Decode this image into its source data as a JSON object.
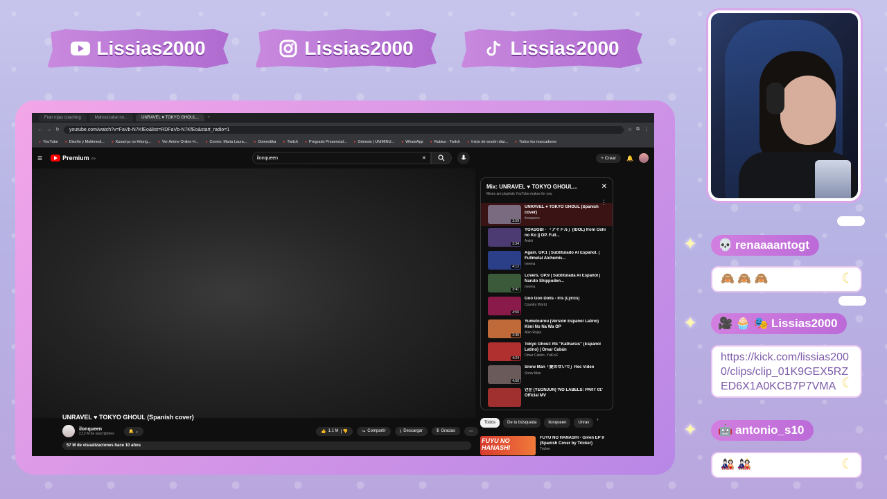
{
  "banners": [
    {
      "platform": "youtube",
      "icon": "youtube-icon",
      "handle": "Lissias2000"
    },
    {
      "platform": "instagram",
      "icon": "instagram-icon",
      "handle": "Lissias2000"
    },
    {
      "platform": "tiktok",
      "icon": "tiktok-icon",
      "handle": "Lissias2000"
    }
  ],
  "browser": {
    "tabs": [
      "Fran rojas coaching",
      "Mahoutsukai no...",
      "UNRAVEL ♥ TOKYO GHOUL..."
    ],
    "url": "youtube.com/watch?v=FaVb-N7KfEo&list=RDFaVb-N7KfEo&start_radio=1",
    "bookmarks": [
      "YouTube",
      "Diseño y Multimedi...",
      "Kusuriya no Hitorig...",
      "Ver Anime Online H...",
      "Correo: Maria Laura...",
      "Domestika",
      "Twitch",
      "Pregrado Presencial...",
      "Génesis | UNIMINU...",
      "WhatsApp",
      "Rubius - Twitch",
      "Inicio de sesión diar...",
      "Todos los marcadores"
    ]
  },
  "youtube": {
    "logo": "Premium",
    "logo_sup": "CO",
    "search_value": "ilonqueen",
    "create_label": "Crear",
    "video_title": "UNRAVEL ♥ TOKYO GHOUL (Spanish cover)",
    "channel": "ilonqueen",
    "subscribers": "2,12 M de suscriptores",
    "likes": "1,1 M",
    "share": "Compartir",
    "download": "Descargar",
    "thanks": "Gracias",
    "views": "57 M de visualizaciones  hace 10 años"
  },
  "playlist": {
    "title": "Mix: UNRAVEL ♥ TOKYO GHOUL...",
    "subtitle": "Mixes are playlists YouTube makes for you",
    "items": [
      {
        "title": "UNRAVEL ♥ TOKYO GHOUL (Spanish cover)",
        "channel": "ilonqueen",
        "duration": "3:59",
        "color": "#7a6b80"
      },
      {
        "title": "YOASOBI - 「アイドル」(IDOL) from Oshi no Ko || OP. Full...",
        "channel": "Anikii",
        "duration": "3:34",
        "color": "#4c3a72"
      },
      {
        "title": "Again. OP.1 | Subtitulado Al Español. | Fullmetal Alchemis...",
        "channel": "meena",
        "duration": "4:12",
        "color": "#2a3f88"
      },
      {
        "title": "Lovers. OP.9 | Subtitulada Al Español | Naruto Shippuden...",
        "channel": "meena",
        "duration": "3:41",
        "color": "#3a5a3a"
      },
      {
        "title": "Goo Goo Dolls - Iris (Lyrics)",
        "channel": "Country World",
        "duration": "4:50",
        "color": "#8a1a4a"
      },
      {
        "title": "Yumetourou (Versión Español Latino) Kimi No Na Wa OP",
        "channel": "Alan Rojas",
        "duration": "2:30",
        "color": "#c06a3a"
      },
      {
        "title": "Tokyo Ghoul: RE \"Katharsis\" (Español Latino) | Omar Cabán",
        "channel": "Omar Cabán -YutFoX",
        "duration": "4:24",
        "color": "#b03030"
      },
      {
        "title": "Snow Man「愛のせいで」Rec Video",
        "channel": "Snow Man",
        "duration": "4:50",
        "color": "#6a5a5a"
      },
      {
        "title": "연준 (YEONJUN) 'NO LABELS: PART 01' Official MV",
        "channel": "",
        "duration": "",
        "color": "#a03030"
      }
    ]
  },
  "chips": [
    "Todos",
    "De tu búsqueda",
    "ilonqueen",
    "Unrav"
  ],
  "recommendation": {
    "thumb_text": "FUYU NO HANASHI",
    "title": "FUYU NO HANASHI - Given EP 9 (Spanish Cover by Tricker)",
    "channel": "Tricker"
  },
  "chat": [
    {
      "user": "renaaaantogt",
      "badges": "💀",
      "message": "🙈 🙈 🙈"
    },
    {
      "user": "Lissias2000",
      "badges": "🎥 🧁 🎭",
      "message": "https://kick.com/lissias2000/clips/clip_01K9GEX5RZED6X1A0KCB7P7VMA"
    },
    {
      "user": "antonio_s10",
      "badges": "🤖",
      "message": "🎎 🎎"
    }
  ]
}
